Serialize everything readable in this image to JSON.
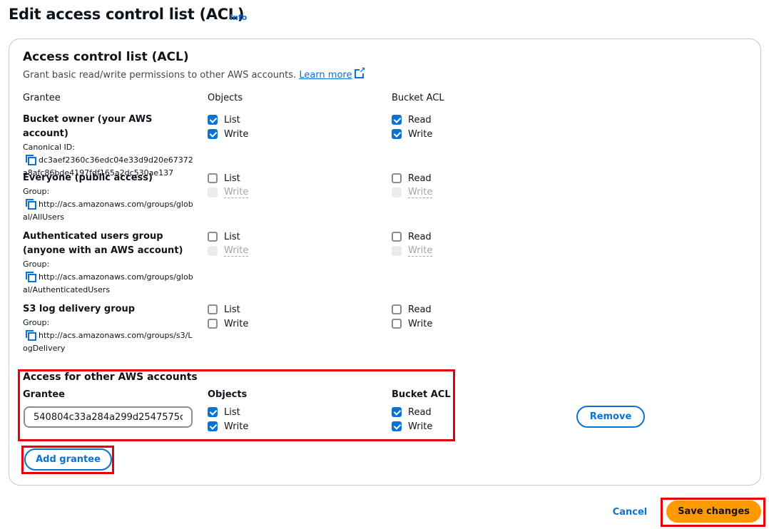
{
  "page": {
    "title": "Edit access control list (ACL)",
    "info_link": "Info"
  },
  "card": {
    "title": "Access control list (ACL)",
    "description": "Grant basic read/write permissions to other AWS accounts.",
    "learn_more": "Learn more",
    "headers": {
      "grantee": "Grantee",
      "objects": "Objects",
      "bucket_acl": "Bucket ACL"
    },
    "grantees": [
      {
        "name": "Bucket owner (your AWS account)",
        "id_label": "Canonical ID:",
        "id_value": "dc3aef2360c36edc04e33d9d20e67372a8afc86bde4197fdf165a2dc530ae137",
        "objects": [
          {
            "label": "List",
            "state": "checked"
          },
          {
            "label": "Write",
            "state": "checked"
          }
        ],
        "bucket_acl": [
          {
            "label": "Read",
            "state": "checked"
          },
          {
            "label": "Write",
            "state": "checked"
          }
        ]
      },
      {
        "name": "Everyone (public access)",
        "id_label": "Group:",
        "id_value": "http://acs.amazonaws.com/groups/global/AllUsers",
        "objects": [
          {
            "label": "List",
            "state": "unchecked"
          },
          {
            "label": "Write",
            "state": "disabled"
          }
        ],
        "bucket_acl": [
          {
            "label": "Read",
            "state": "unchecked"
          },
          {
            "label": "Write",
            "state": "disabled"
          }
        ]
      },
      {
        "name": "Authenticated users group (anyone with an AWS account)",
        "id_label": "Group:",
        "id_value": "http://acs.amazonaws.com/groups/global/AuthenticatedUsers",
        "objects": [
          {
            "label": "List",
            "state": "unchecked"
          },
          {
            "label": "Write",
            "state": "disabled"
          }
        ],
        "bucket_acl": [
          {
            "label": "Read",
            "state": "unchecked"
          },
          {
            "label": "Write",
            "state": "disabled"
          }
        ]
      },
      {
        "name": "S3 log delivery group",
        "id_label": "Group:",
        "id_value": "http://acs.amazonaws.com/groups/s3/LogDelivery",
        "objects": [
          {
            "label": "List",
            "state": "unchecked"
          },
          {
            "label": "Write",
            "state": "unchecked"
          }
        ],
        "bucket_acl": [
          {
            "label": "Read",
            "state": "unchecked"
          },
          {
            "label": "Write",
            "state": "unchecked"
          }
        ]
      }
    ],
    "other_accounts": {
      "title": "Access for other AWS accounts",
      "headers": {
        "grantee": "Grantee",
        "objects": "Objects",
        "bucket_acl": "Bucket ACL"
      },
      "grantee_value": "540804c33a284a299d2547575c",
      "objects": [
        {
          "label": "List",
          "state": "checked"
        },
        {
          "label": "Write",
          "state": "checked"
        }
      ],
      "bucket_acl": [
        {
          "label": "Read",
          "state": "checked"
        },
        {
          "label": "Write",
          "state": "checked"
        }
      ],
      "remove_label": "Remove",
      "add_grantee_label": "Add grantee"
    }
  },
  "footer": {
    "cancel_label": "Cancel",
    "save_label": "Save changes"
  },
  "colors": {
    "accent": "#0972d3",
    "primary_button": "#ff9900",
    "highlight": "#e8000b"
  }
}
